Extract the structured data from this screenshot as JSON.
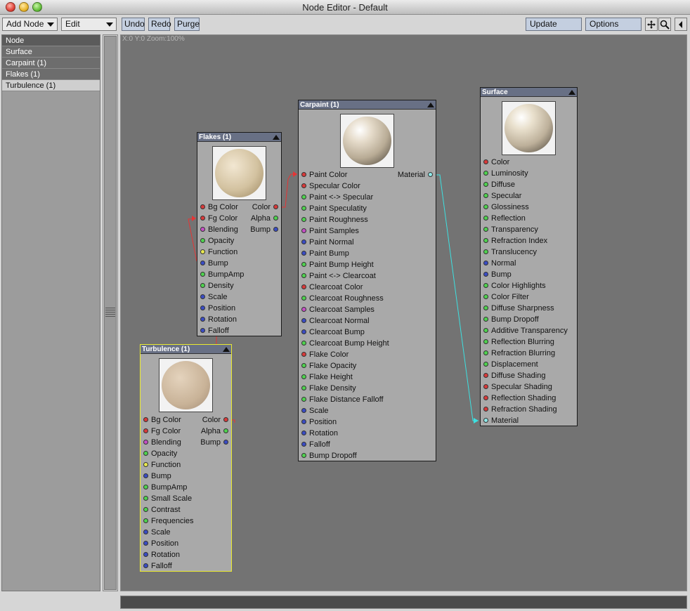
{
  "window": {
    "title": "Node Editor - Default"
  },
  "toolbar": {
    "add_node": "Add Node",
    "edit": "Edit",
    "undo": "Undo",
    "redo": "Redo",
    "purge": "Purge",
    "update": "Update",
    "options": "Options"
  },
  "icons": [
    "move-icon",
    "zoom-icon",
    "collapse-arrow-icon",
    "collapse-triangle-icon"
  ],
  "colors": {
    "color_port": "#d83a3a",
    "scalar_port": "#4fd24f",
    "vector_port": "#3a4cc4",
    "integer_port": "#c64fc6",
    "function_port": "#e8e84f",
    "material_port": "#8ee8e8",
    "selected_outline": "#eaea30"
  },
  "node_list": {
    "header": "Node",
    "items": [
      "Surface",
      "Carpaint (1)",
      "Flakes (1)",
      "Turbulence (1)"
    ],
    "selected": "Turbulence (1)"
  },
  "canvas": {
    "coords": "X:0 Y:0 Zoom:100%"
  },
  "nodes": {
    "flakes": {
      "title": "Flakes (1)",
      "inputs": [
        "Bg Color",
        "Fg Color",
        "Blending",
        "Opacity",
        "Function",
        "Bump",
        "BumpAmp",
        "Density",
        "Scale",
        "Position",
        "Rotation",
        "Falloff"
      ],
      "outputs": [
        "Color",
        "Alpha",
        "Bump"
      ]
    },
    "turbulence": {
      "title": "Turbulence (1)",
      "inputs": [
        "Bg Color",
        "Fg Color",
        "Blending",
        "Opacity",
        "Function",
        "Bump",
        "BumpAmp",
        "Small Scale",
        "Contrast",
        "Frequencies",
        "Scale",
        "Position",
        "Rotation",
        "Falloff"
      ],
      "outputs": [
        "Color",
        "Alpha",
        "Bump"
      ]
    },
    "carpaint": {
      "title": "Carpaint (1)",
      "inputs": [
        "Paint Color",
        "Specular Color",
        "Paint <-> Specular",
        "Paint Speculatity",
        "Paint Roughness",
        "Paint Samples",
        "Paint Normal",
        "Paint Bump",
        "Paint Bump Height",
        "Paint <-> Clearcoat",
        "Clearcoat Color",
        "Clearcoat Roughness",
        "Clearcoat Samples",
        "Clearcoat Normal",
        "Clearcoat Bump",
        "Clearcoat Bump Height",
        "Flake Color",
        "Flake Opacity",
        "Flake Height",
        "Flake Density",
        "Flake Distance Falloff",
        "Scale",
        "Position",
        "Rotation",
        "Falloff",
        "Bump Dropoff"
      ],
      "outputs": [
        "Material"
      ]
    },
    "surface": {
      "title": "Surface",
      "inputs": [
        "Color",
        "Luminosity",
        "Diffuse",
        "Specular",
        "Glossiness",
        "Reflection",
        "Transparency",
        "Refraction Index",
        "Translucency",
        "Normal",
        "Bump",
        "Color Highlights",
        "Color Filter",
        "Diffuse Sharpness",
        "Bump Dropoff",
        "Additive Transparency",
        "Reflection Blurring",
        "Refraction Blurring",
        "Displacement",
        "Diffuse Shading",
        "Specular Shading",
        "Reflection Shading",
        "Refraction Shading",
        "Material"
      ]
    }
  }
}
